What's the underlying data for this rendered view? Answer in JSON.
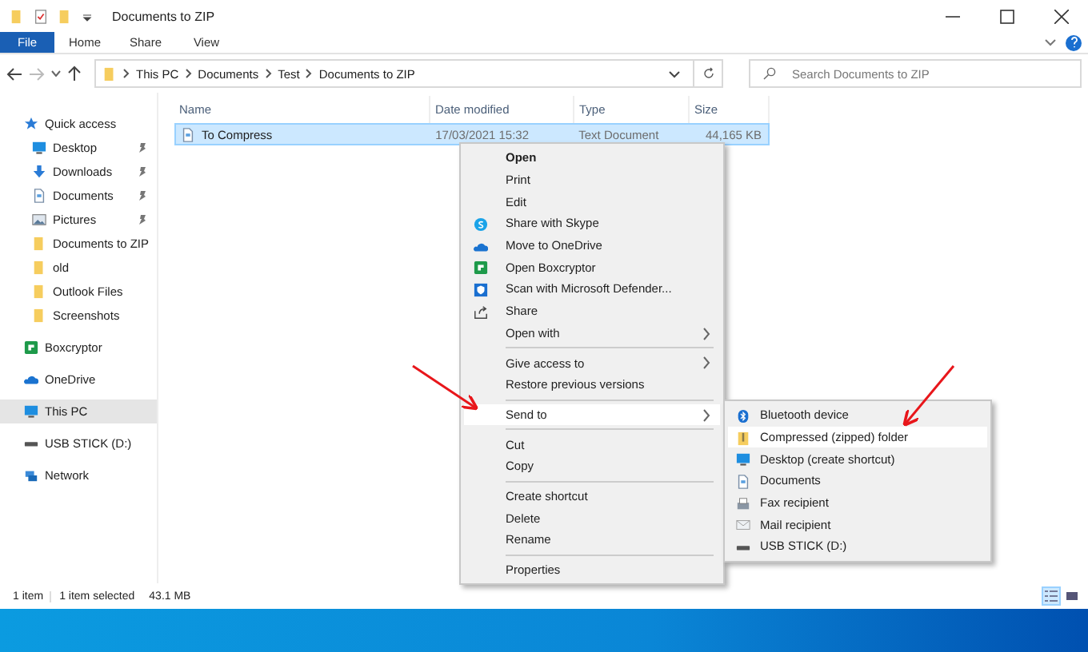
{
  "window": {
    "title": "Documents to ZIP"
  },
  "ribbon_tabs": [
    {
      "label": "File",
      "kind": "file"
    },
    {
      "label": "Home",
      "kind": "tab"
    },
    {
      "label": "Share",
      "kind": "tab"
    },
    {
      "label": "View",
      "kind": "tab"
    }
  ],
  "address_bar": {
    "breadcrumbs": [
      "This PC",
      "Documents",
      "Test",
      "Documents to ZIP"
    ]
  },
  "search": {
    "placeholder": "Search Documents to ZIP"
  },
  "sidebar": {
    "items": [
      {
        "label": "Quick access",
        "kind": "star",
        "selected": false,
        "children": [
          {
            "label": "Desktop",
            "kind": "desktop",
            "pinned": true,
            "selected": false
          },
          {
            "label": "Downloads",
            "kind": "download",
            "pinned": true,
            "selected": false
          },
          {
            "label": "Documents",
            "kind": "document",
            "pinned": true,
            "selected": false
          },
          {
            "label": "Pictures",
            "kind": "picture",
            "pinned": true,
            "selected": false
          },
          {
            "label": "Documents to ZIP",
            "kind": "folder",
            "pinned": false,
            "selected": false
          },
          {
            "label": "old",
            "kind": "folder",
            "pinned": false,
            "selected": false
          },
          {
            "label": "Outlook Files",
            "kind": "folder",
            "pinned": false,
            "selected": false
          },
          {
            "label": "Screenshots",
            "kind": "folder",
            "pinned": false,
            "selected": false
          }
        ]
      },
      {
        "label": "Boxcryptor",
        "kind": "boxcryptor",
        "selected": false
      },
      {
        "label": "OneDrive",
        "kind": "cloud",
        "selected": false
      },
      {
        "label": "This PC",
        "kind": "desktop",
        "selected": true
      },
      {
        "label": "USB STICK (D:)",
        "kind": "drive",
        "selected": false
      },
      {
        "label": "Network",
        "kind": "network",
        "selected": false
      }
    ]
  },
  "table": {
    "columns": [
      "Name",
      "Date modified",
      "Type",
      "Size"
    ],
    "rows": [
      {
        "name": "To Compress",
        "date_modified": "17/03/2021 15:32",
        "type": "Text Document",
        "size": "44,165 KB",
        "selected": true
      }
    ]
  },
  "context_menu": {
    "items": [
      {
        "kind": "plain",
        "label": "Open",
        "default": true,
        "submenu": false,
        "selected": false
      },
      {
        "kind": "plain",
        "label": "Print",
        "default": false,
        "submenu": false,
        "selected": false
      },
      {
        "kind": "plain",
        "label": "Edit",
        "default": false,
        "submenu": false,
        "selected": false
      },
      {
        "kind": "skype",
        "label": "Share with Skype",
        "default": false,
        "submenu": false,
        "selected": false
      },
      {
        "kind": "cloud",
        "label": "Move to OneDrive",
        "default": false,
        "submenu": false,
        "selected": false
      },
      {
        "kind": "boxcryptor",
        "label": "Open Boxcryptor",
        "default": false,
        "submenu": false,
        "selected": false
      },
      {
        "kind": "shield",
        "label": "Scan with Microsoft Defender...",
        "default": false,
        "submenu": false,
        "selected": false
      },
      {
        "kind": "share",
        "label": "Share",
        "default": false,
        "submenu": false,
        "selected": false
      },
      {
        "kind": "plain",
        "label": "Open with",
        "default": false,
        "submenu": true,
        "selected": false
      },
      {
        "kind": "separator"
      },
      {
        "kind": "plain",
        "label": "Give access to",
        "default": false,
        "submenu": true,
        "selected": false
      },
      {
        "kind": "plain",
        "label": "Restore previous versions",
        "default": false,
        "submenu": false,
        "selected": false
      },
      {
        "kind": "separator"
      },
      {
        "kind": "plain",
        "label": "Send to",
        "default": false,
        "submenu": true,
        "selected": true
      },
      {
        "kind": "separator"
      },
      {
        "kind": "plain",
        "label": "Cut",
        "default": false,
        "submenu": false,
        "selected": false
      },
      {
        "kind": "plain",
        "label": "Copy",
        "default": false,
        "submenu": false,
        "selected": false
      },
      {
        "kind": "separator"
      },
      {
        "kind": "plain",
        "label": "Create shortcut",
        "default": false,
        "submenu": false,
        "selected": false
      },
      {
        "kind": "plain",
        "label": "Delete",
        "default": false,
        "submenu": false,
        "selected": false
      },
      {
        "kind": "plain",
        "label": "Rename",
        "default": false,
        "submenu": false,
        "selected": false
      },
      {
        "kind": "separator"
      },
      {
        "kind": "plain",
        "label": "Properties",
        "default": false,
        "submenu": false,
        "selected": false
      }
    ]
  },
  "send_to_menu": {
    "items": [
      {
        "label": "Bluetooth device",
        "kind": "bluetooth",
        "selected": false
      },
      {
        "label": "Compressed (zipped) folder",
        "kind": "zip",
        "selected": true
      },
      {
        "label": "Desktop (create shortcut)",
        "kind": "desktop",
        "selected": false
      },
      {
        "label": "Documents",
        "kind": "document",
        "selected": false
      },
      {
        "label": "Fax recipient",
        "kind": "fax",
        "selected": false
      },
      {
        "label": "Mail recipient",
        "kind": "mail",
        "selected": false
      },
      {
        "label": "USB STICK (D:)",
        "kind": "drive",
        "selected": false
      }
    ]
  },
  "status_bar": {
    "texts": [
      "1 item",
      "1 item selected",
      "43.1 MB"
    ],
    "views": [
      {
        "kind": "details",
        "selected": true
      },
      {
        "kind": "large_icons",
        "selected": false
      }
    ]
  }
}
